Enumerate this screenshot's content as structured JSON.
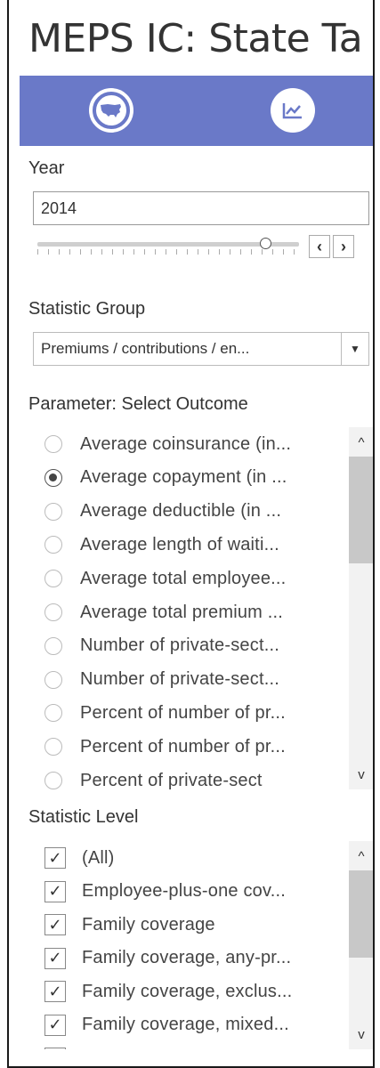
{
  "title": "MEPS IC: State Ta",
  "nav": {
    "items": [
      {
        "icon": "us-map-icon"
      },
      {
        "icon": "trend-chart-icon"
      }
    ]
  },
  "year": {
    "label": "Year",
    "value": "2014",
    "slider_fraction": 0.87,
    "prev_glyph": "‹",
    "next_glyph": "›"
  },
  "statistic_group": {
    "label": "Statistic Group",
    "selected": "Premiums / contributions / en..."
  },
  "outcome": {
    "label": "Parameter: Select Outcome",
    "options": [
      {
        "label": "Average coinsurance (in...",
        "selected": false
      },
      {
        "label": "Average copayment (in ...",
        "selected": true
      },
      {
        "label": "Average deductible (in ...",
        "selected": false
      },
      {
        "label": "Average length of waiti...",
        "selected": false
      },
      {
        "label": "Average total employee...",
        "selected": false
      },
      {
        "label": "Average total premium ...",
        "selected": false
      },
      {
        "label": "Number of private-sect...",
        "selected": false
      },
      {
        "label": "Number of private-sect...",
        "selected": false
      },
      {
        "label": "Percent of number of pr...",
        "selected": false
      },
      {
        "label": "Percent of number of pr...",
        "selected": false
      },
      {
        "label": "Percent of private-sect",
        "selected": false
      }
    ]
  },
  "level": {
    "label": "Statistic Level",
    "options": [
      {
        "label": "(All)",
        "checked": true
      },
      {
        "label": "Employee-plus-one cov...",
        "checked": true
      },
      {
        "label": "Family coverage",
        "checked": true
      },
      {
        "label": "Family coverage, any-pr...",
        "checked": true
      },
      {
        "label": "Family coverage, exclus...",
        "checked": true
      },
      {
        "label": "Family coverage, mixed...",
        "checked": true
      },
      {
        "label": "",
        "checked": true
      }
    ]
  },
  "glyphs": {
    "up": "^",
    "down": "v",
    "check": "✓",
    "dropdown": "▼"
  }
}
